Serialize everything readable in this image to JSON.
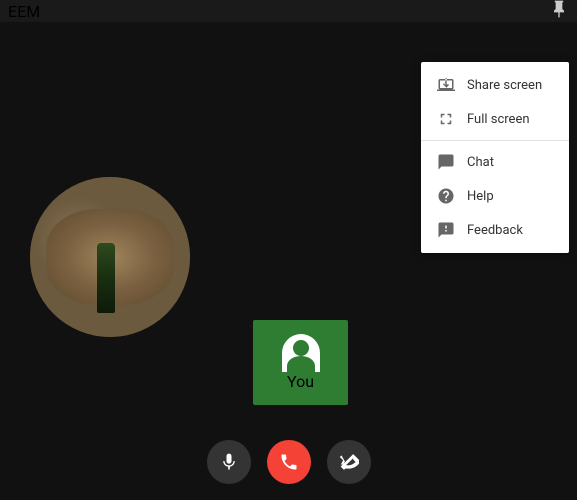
{
  "titlebar": {
    "title": "EEM",
    "pin_label": "📌"
  },
  "menu": {
    "items": [
      {
        "id": "share-screen",
        "label": "Share screen",
        "icon": "share-screen-icon"
      },
      {
        "id": "full-screen",
        "label": "Full screen",
        "icon": "fullscreen-icon"
      },
      {
        "id": "chat",
        "label": "Chat",
        "icon": "chat-icon"
      },
      {
        "id": "help",
        "label": "Help",
        "icon": "help-icon"
      },
      {
        "id": "feedback",
        "label": "Feedback",
        "icon": "feedback-icon"
      }
    ]
  },
  "remote_tile": {
    "label": "You"
  },
  "controls": {
    "mic_title": "Mute",
    "hangup_title": "End call",
    "video_title": "Turn off camera"
  }
}
